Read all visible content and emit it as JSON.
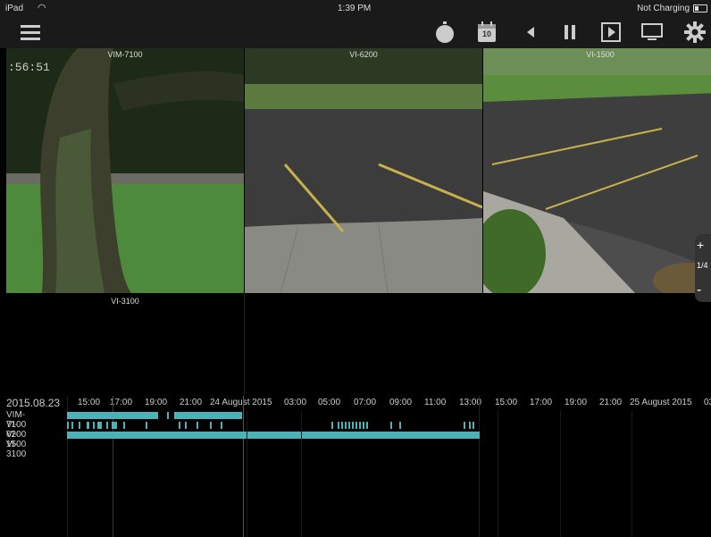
{
  "status_bar": {
    "device": "iPad",
    "time": "1:39 PM",
    "battery_status": "Not Charging"
  },
  "toolbar": {
    "icons": [
      "menu-icon",
      "stopwatch-icon",
      "calendar-icon",
      "step-back-icon",
      "pause-icon",
      "play-icon",
      "monitor-icon",
      "gear-icon"
    ],
    "calendar_day": "10"
  },
  "cameras": [
    {
      "name": "VIM-7100",
      "time_overlay": ":56:51"
    },
    {
      "name": "VI-6200"
    },
    {
      "name": "VI-1500"
    },
    {
      "name": "VI-3100"
    }
  ],
  "zoom": {
    "plus": "+",
    "level": "1/4",
    "minus": "-"
  },
  "timeline": {
    "date": "2015.08.23",
    "ticks": [
      "15:00",
      "17:00",
      "19:00",
      "21:00",
      "24 August 2015",
      "03:00",
      "05:00",
      "07:00",
      "09:00",
      "11:00",
      "13:00",
      "15:00",
      "17:00",
      "19:00",
      "21:00",
      "25 August 2015",
      "03"
    ],
    "rows": [
      "VIM-7100",
      "VI-6200",
      "VI-1500",
      "VI-3100"
    ]
  },
  "colors": {
    "accent": "#4bb3b8",
    "background": "#000000",
    "bar": "#1a1a1a"
  }
}
